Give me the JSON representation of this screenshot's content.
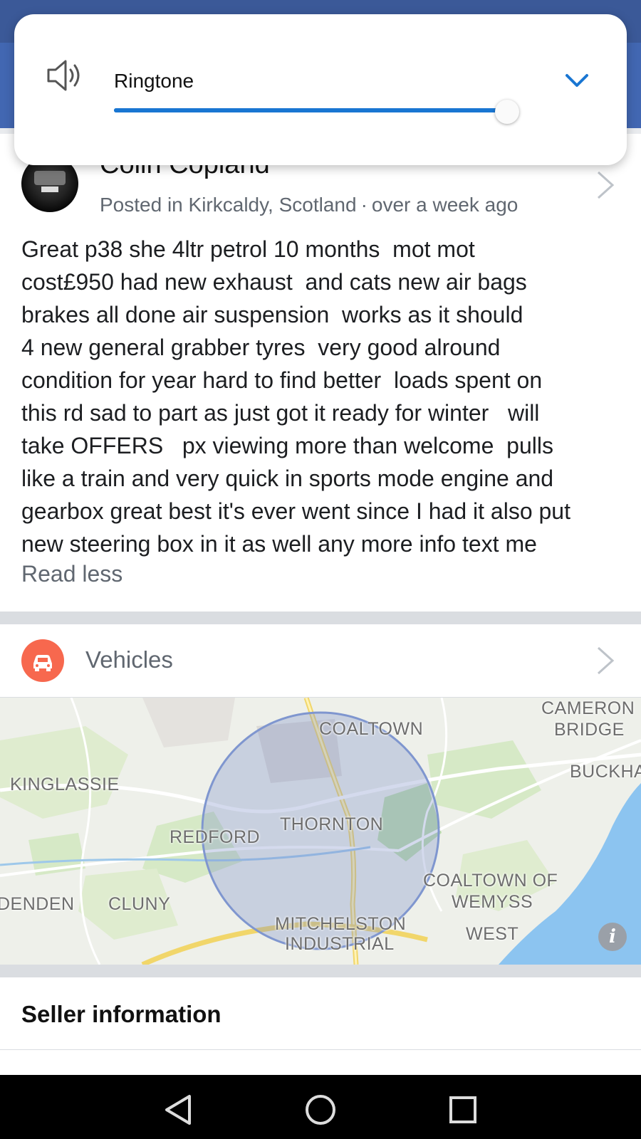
{
  "volume": {
    "label": "Ringtone",
    "level": 0.95,
    "accent": "#1976d2"
  },
  "post": {
    "author": "Colin Copland",
    "location": "Posted in Kirkcaldy, Scotland",
    "separator": "·",
    "time": "over a week ago",
    "description": "Great p38 she 4ltr petrol 10 months  mot mot\ncost£950 had new exhaust  and cats new air bags\nbrakes all done air suspension  works as it should\n4 new general grabber tyres  very good alround\ncondition for year hard to find better  loads spent on\nthis rd sad to part as just got it ready for winter   will\ntake OFFERS   px viewing more than welcome  pulls\nlike a train and very quick in sports mode engine and\ngearbox great best it's ever went since I had it also put\nnew steering box in it as well any more info text me",
    "read_less": "Read less"
  },
  "category": {
    "label": "Vehicles",
    "icon": "car-icon",
    "icon_color": "#f7684e"
  },
  "map": {
    "labels": {
      "coaltown": "COALTOWN",
      "cameron": "CAMERON",
      "bridge": "BRIDGE",
      "buckhaven": "BUCKHA",
      "kinglassie": "KINGLASSIE",
      "thornton": "THORNTON",
      "redford": "REDFORD",
      "denden": "DENDEN",
      "cluny": "CLUNY",
      "coaltown_of": "COALTOWN OF",
      "wemyss": "WEMYSS",
      "mitchelston": "MITCHELSTON",
      "industrial": "INDUSTRIAL",
      "west": "WEST"
    },
    "info_symbol": "i"
  },
  "seller": {
    "title": "Seller information"
  },
  "navbar": {
    "back": "back-icon",
    "home": "home-icon",
    "recents": "recents-icon"
  }
}
